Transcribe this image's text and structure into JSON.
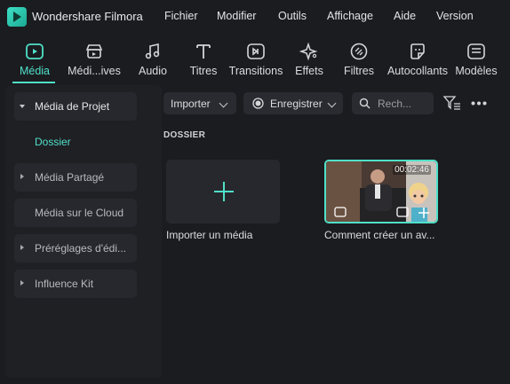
{
  "app": {
    "name": "Wondershare Filmora"
  },
  "menu": [
    "Fichier",
    "Modifier",
    "Outils",
    "Affichage",
    "Aide",
    "Version"
  ],
  "toolbar": [
    {
      "label": "Média",
      "icon": "media-icon",
      "active": true
    },
    {
      "label": "Médi...ives",
      "icon": "stock-media-icon",
      "active": false
    },
    {
      "label": "Audio",
      "icon": "music-note-icon",
      "active": false
    },
    {
      "label": "Titres",
      "icon": "text-icon",
      "active": false
    },
    {
      "label": "Transitions",
      "icon": "transition-icon",
      "active": false
    },
    {
      "label": "Effets",
      "icon": "effects-sparkle-icon",
      "active": false
    },
    {
      "label": "Filtres",
      "icon": "filter-icon",
      "active": false
    },
    {
      "label": "Autocollants",
      "icon": "sticker-icon",
      "active": false
    },
    {
      "label": "Modèles",
      "icon": "templates-icon",
      "active": false
    }
  ],
  "sidebar": {
    "project_media": "Média de Projet",
    "folder": "Dossier",
    "shared_media": "Média Partagé",
    "cloud_media": "Média sur le Cloud",
    "presets": "Préréglages d'édi...",
    "influence_kit": "Influence Kit"
  },
  "main": {
    "import_button": "Importer",
    "record_button": "Enregistrer",
    "search_placeholder": "Rech...",
    "section_title": "DOSSIER",
    "import_card_label": "Importer un média",
    "video_card_label": "Comment créer un av...",
    "video_duration": "00:02:46"
  },
  "colors": {
    "accent": "#4fe0c8",
    "background": "#1b1c20",
    "panel": "#27282d"
  }
}
